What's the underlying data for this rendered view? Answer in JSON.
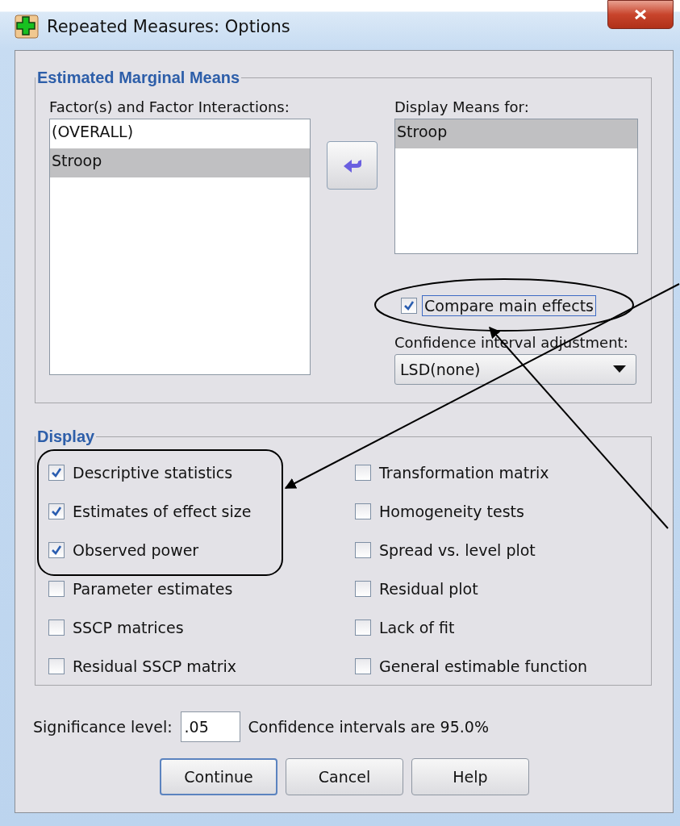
{
  "window": {
    "title": "Repeated Measures: Options"
  },
  "estimated_marginal_means": {
    "title": "Estimated Marginal Means",
    "factors_label": "Factor(s) and Factor Interactions:",
    "factors": [
      {
        "label": "(OVERALL)",
        "selected": false
      },
      {
        "label": "Stroop",
        "selected": true
      }
    ],
    "display_means_label": "Display Means for:",
    "display_means": [
      {
        "label": "Stroop",
        "selected": true
      }
    ],
    "compare_main_effects": {
      "label": "Compare main effects",
      "checked": true,
      "focused": true
    },
    "ci_adjustment_label": "Confidence interval adjustment:",
    "ci_adjustment": {
      "value": "LSD(none)"
    }
  },
  "display": {
    "title": "Display",
    "options": [
      {
        "label": "Descriptive statistics",
        "checked": true
      },
      {
        "label": "Estimates of effect size",
        "checked": true
      },
      {
        "label": "Observed power",
        "checked": true
      },
      {
        "label": "Parameter estimates",
        "checked": false
      },
      {
        "label": "SSCP matrices",
        "checked": false
      },
      {
        "label": "Residual SSCP matrix",
        "checked": false
      },
      {
        "label": "Transformation matrix",
        "checked": false
      },
      {
        "label": "Homogeneity tests",
        "checked": false
      },
      {
        "label": "Spread vs. level plot",
        "checked": false
      },
      {
        "label": "Residual plot",
        "checked": false
      },
      {
        "label": "Lack of fit",
        "checked": false
      },
      {
        "label": "General estimable function",
        "checked": false
      }
    ]
  },
  "significance": {
    "label": "Significance level:",
    "value": ".05",
    "note": "Confidence intervals are 95.0%"
  },
  "buttons": [
    {
      "label": "Continue",
      "default": true
    },
    {
      "label": "Cancel",
      "default": false
    },
    {
      "label": "Help",
      "default": false
    }
  ]
}
